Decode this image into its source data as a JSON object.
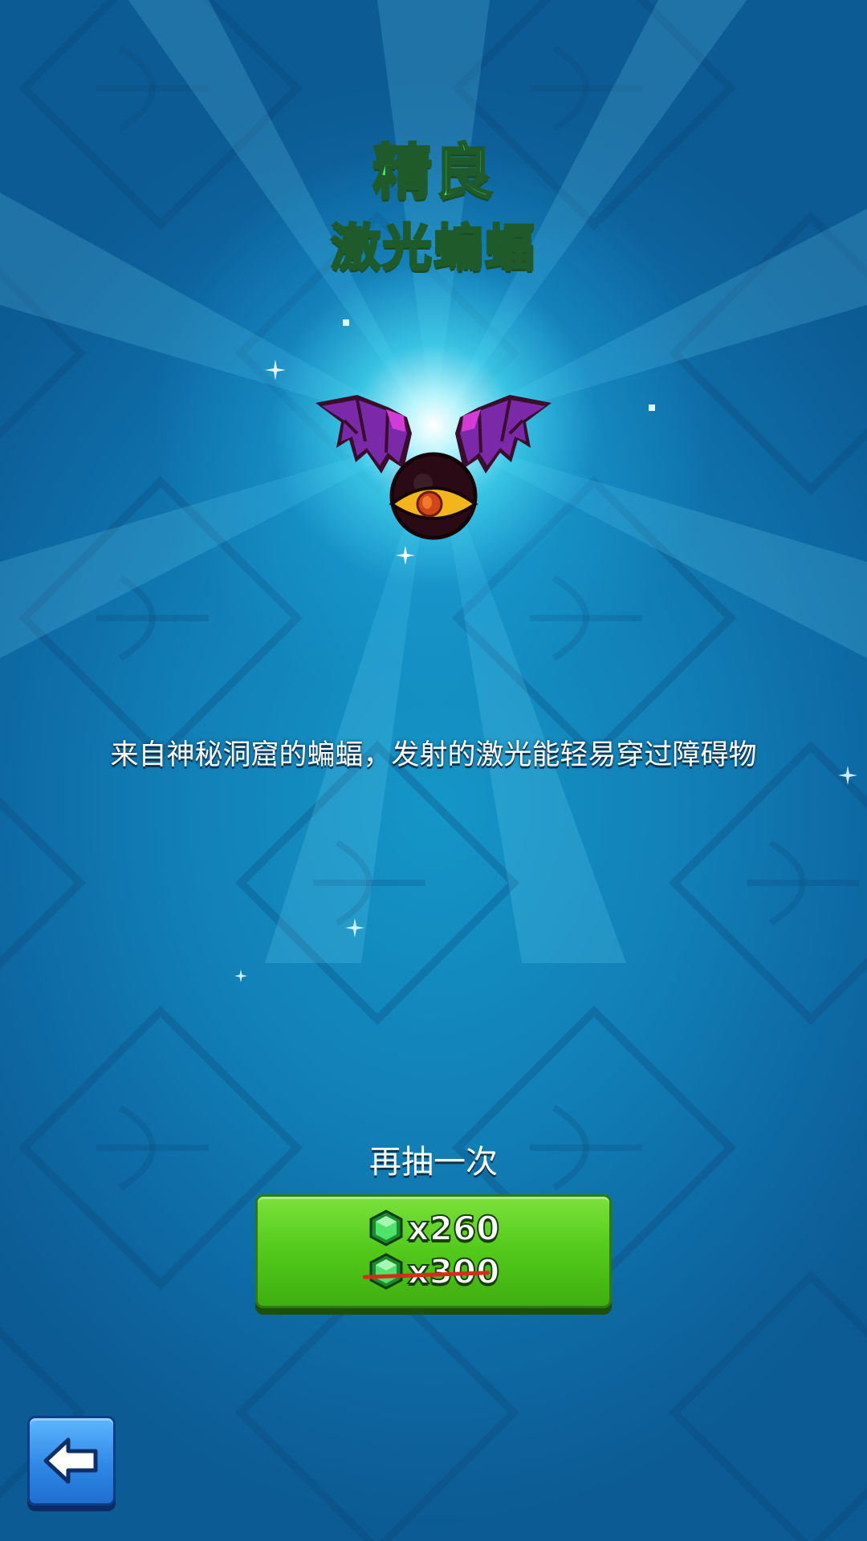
{
  "hero": {
    "rarity": "精良",
    "name": "激光蝙蝠",
    "description": "来自神秘洞窟的蝙蝠，发射的激光能轻易穿过障碍物",
    "image_icon": "laser-bat-icon"
  },
  "draw_again": {
    "label": "再抽一次",
    "price": "x260",
    "original_price": "x300",
    "currency_icon": "green-gem-icon"
  },
  "navigation": {
    "back_icon": "back-arrow-icon"
  },
  "colors": {
    "rarity_green": "#4fe36b",
    "button_green": "#52c91a",
    "back_blue": "#2f88e6",
    "background": "#1180b6"
  }
}
